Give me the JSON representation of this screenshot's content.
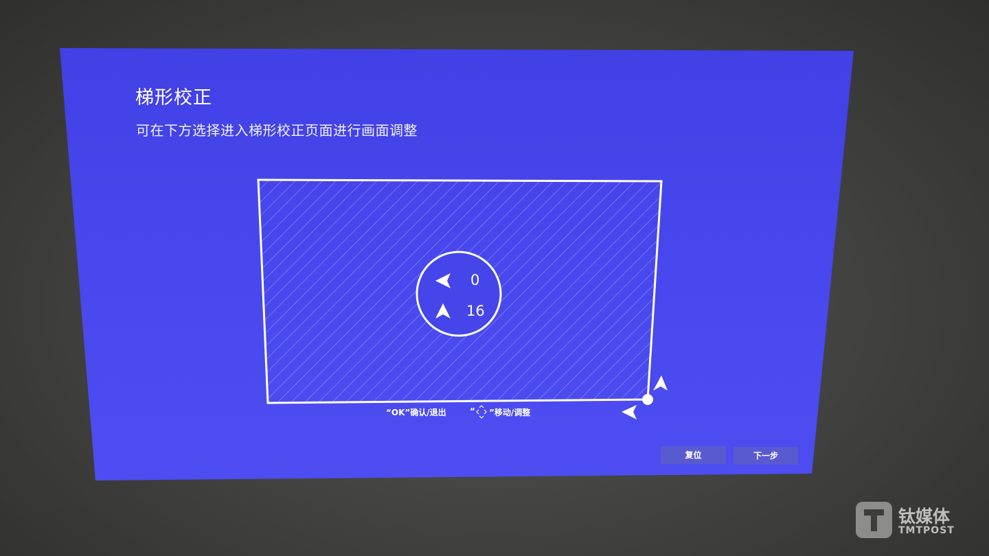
{
  "screen": {
    "title": "梯形校正",
    "subtitle": "可在下方选择进入梯形校正页面进行画面调整"
  },
  "keystone": {
    "horizontal_value": "0",
    "vertical_value": "16",
    "horizontal_icon": "arrow-left-icon",
    "vertical_icon": "arrow-up-icon"
  },
  "hints": {
    "ok_hint": "“OK”确认/退出",
    "move_hint_open": "“",
    "move_hint_text": "”移动/调整",
    "move_icon": "dpad-icon"
  },
  "buttons": {
    "reset": "复位",
    "next": "下一步"
  },
  "watermark": {
    "brand_cn": "钛媒体",
    "brand_en": "TMTPOST"
  },
  "colors": {
    "projection_blue": "#4545ea",
    "line_white": "#ffffff",
    "button_bg": "#5a5ad0"
  }
}
